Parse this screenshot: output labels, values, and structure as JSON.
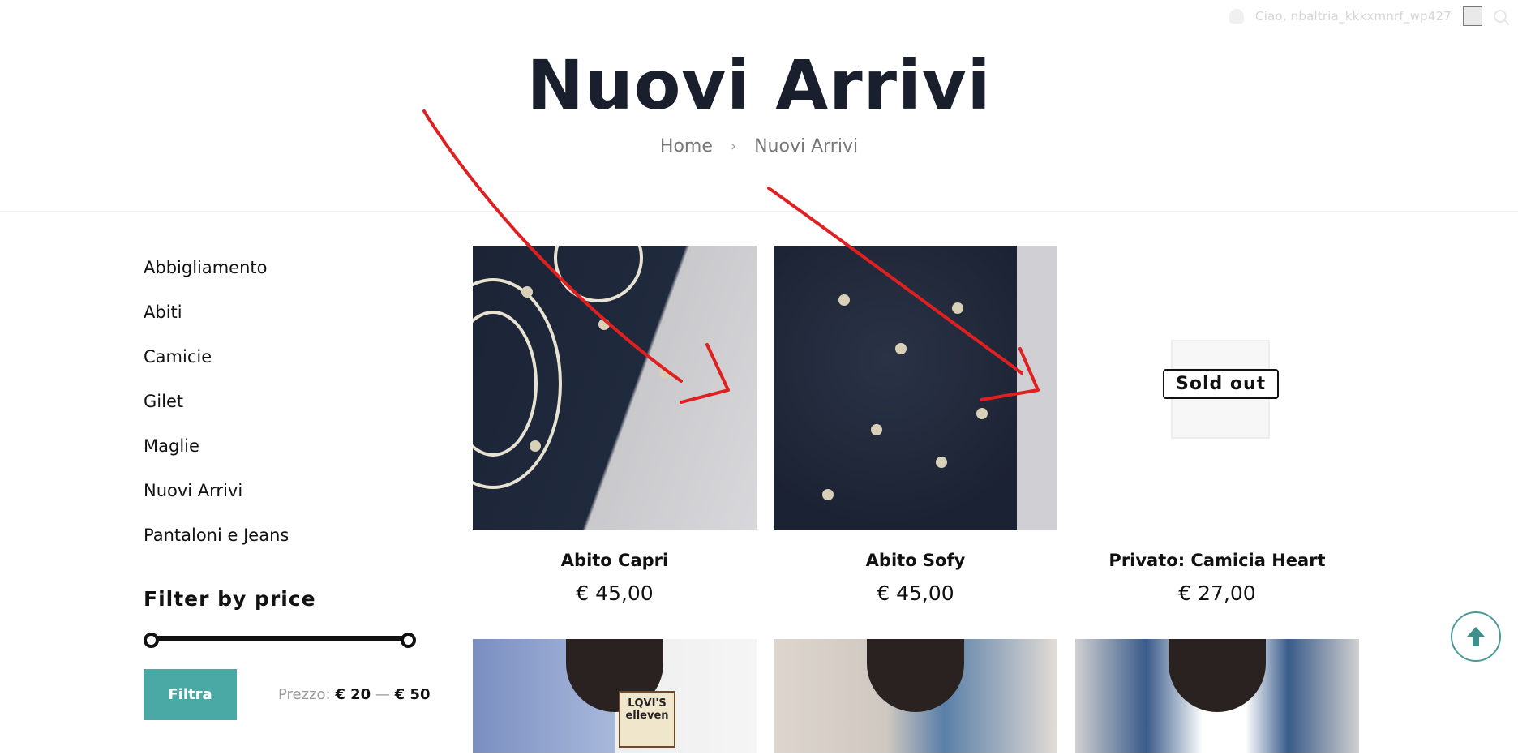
{
  "topbar": {
    "greeting": "Ciao, nbaltria_kkkxmnrf_wp427"
  },
  "hero": {
    "title": "Nuovi Arrivi",
    "breadcrumb": [
      {
        "label": "Home"
      },
      {
        "label": "Nuovi Arrivi"
      }
    ]
  },
  "sidebar": {
    "categories": [
      {
        "label": "Abbigliamento"
      },
      {
        "label": "Abiti"
      },
      {
        "label": "Camicie"
      },
      {
        "label": "Gilet"
      },
      {
        "label": "Maglie"
      },
      {
        "label": "Nuovi Arrivi"
      },
      {
        "label": "Pantaloni e Jeans"
      }
    ],
    "filter": {
      "title": "Filter by price",
      "button": "Filtra",
      "price_label": "Prezzo:",
      "min": "€ 20",
      "dash": "—",
      "max": "€ 50"
    }
  },
  "products": [
    {
      "name": "Abito Capri",
      "price": "€ 45,00"
    },
    {
      "name": "Abito Sofy",
      "price": "€ 45,00"
    },
    {
      "name": "Privato: Camicia Heart",
      "price": "€ 27,00",
      "badge": "Sold out"
    }
  ],
  "row2_badge_text": "LQVI'S elleven",
  "colors": {
    "accent": "#4aa9a4",
    "title": "#1a1f2e",
    "annotation": "#e02020"
  }
}
